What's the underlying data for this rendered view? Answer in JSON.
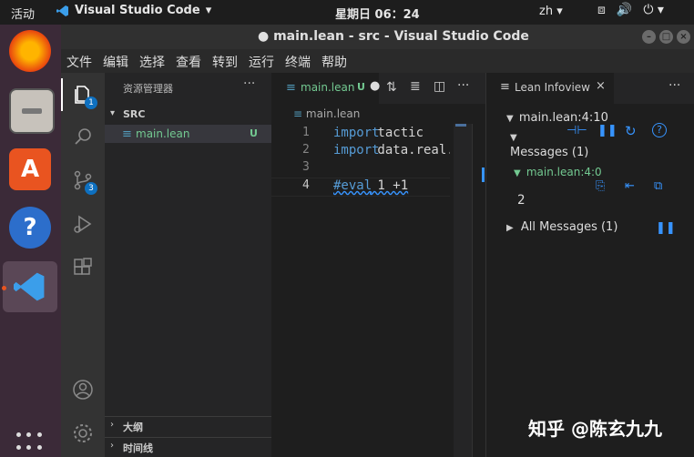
{
  "topbar": {
    "activities": "活动",
    "app_name": "Visual Studio Code",
    "clock": "星期日 06：24",
    "ime": "zh"
  },
  "window": {
    "title": "main.lean - src - Visual Studio Code"
  },
  "menu": [
    "文件",
    "编辑",
    "选择",
    "查看",
    "转到",
    "运行",
    "终端",
    "帮助"
  ],
  "activity_badges": {
    "explorer": "1",
    "scm": "3"
  },
  "sidebar": {
    "title": "资源管理器",
    "folder": "SRC",
    "file": {
      "name": "main.lean",
      "status": "U"
    },
    "outline": "大纲",
    "timeline": "时间线"
  },
  "editor": {
    "tab": {
      "name": "main.lean",
      "status": "U"
    },
    "breadcrumb": "main.lean",
    "lines": [
      {
        "num": "1",
        "kw": "import",
        "rest": " tactic"
      },
      {
        "num": "2",
        "kw": "import",
        "rest": " data.real.bas"
      },
      {
        "num": "3",
        "kw": "",
        "rest": ""
      },
      {
        "num": "4",
        "kw": "#eval",
        "rest": " 1 +1"
      }
    ]
  },
  "infoview": {
    "tab": "Lean Infoview",
    "position": "main.lean:4:10",
    "messages_header": "Messages (1)",
    "message_loc": "main.lean:4:0",
    "message_value": "2",
    "all_messages": "All Messages (1)"
  },
  "watermark": "知乎 @陈玄九九",
  "colors": {
    "accent": "#3794ff",
    "modified": "#73c991",
    "keyword": "#569cd6",
    "dock": "#3b2a38"
  }
}
